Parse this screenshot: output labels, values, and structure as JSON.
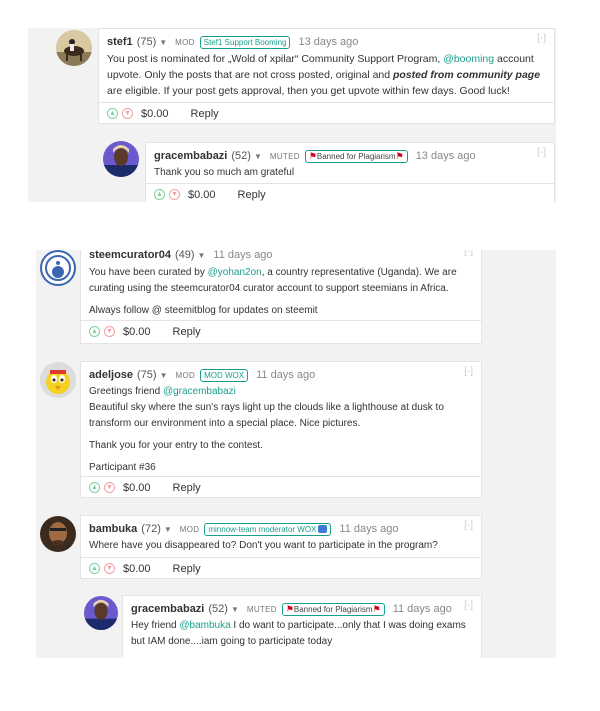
{
  "thread1": {
    "stef1": {
      "author": "stef1",
      "rep": "(75)",
      "role": "MOD",
      "tag": "Stef1 Support Booming",
      "time": "13 days ago",
      "collapse": "[-]",
      "body": {
        "p1": "You post is nominated for „Wold of xpilar“ Community Support Program, ",
        "link": "@booming",
        "p2": " account upvote. Only the posts that are not cross posted, original and ",
        "bold": "posted from community page",
        "p3": " are eligible. If your post gets approval, then you get upvote within few days. Good luck!"
      },
      "payout": "$0.00",
      "reply": "Reply"
    },
    "grace1": {
      "author": "gracembabazi",
      "rep": "(52)",
      "role": "MUTED",
      "tag": "Banned for Plagiarism",
      "time": "13 days ago",
      "collapse": "[-]",
      "body": "Thank you so much am grateful",
      "payout": "$0.00",
      "reply": "Reply"
    }
  },
  "thread2": {
    "curator": {
      "author": "steemcurator04",
      "rep": "(49)",
      "time": "11 days ago",
      "collapse": "[-]",
      "body": {
        "p1a": "You have been curated by ",
        "link": "@yohan2on",
        "p1b": ", a country representative (Uganda). We are curating using the steemcurator04 curator account to support steemians in Africa.",
        "p2": "Always follow @ steemitblog for updates on steemit"
      },
      "payout": "$0.00",
      "reply": "Reply"
    },
    "adel": {
      "author": "adeljose",
      "rep": "(75)",
      "role": "MOD",
      "tag": "MOD WOX",
      "time": "11 days ago",
      "collapse": "[-]",
      "body": {
        "greet": "Greetings friend ",
        "link": "@gracembabazi",
        "p1": "Beautiful sky where the sun's rays light up the clouds like a lighthouse at dusk to transform our environment into a special place. Nice pictures.",
        "p2": "Thank you for your entry to the contest.",
        "p3": "Participant #36"
      },
      "payout": "$0.00",
      "reply": "Reply"
    },
    "bambuka": {
      "author": "bambuka",
      "rep": "(72)",
      "role": "MOD",
      "tag": "minnow-team moderator WOX",
      "time": "11 days ago",
      "collapse": "[-]",
      "body": "Where have you disappeared to? Don't you want to participate in the program?",
      "payout": "$0.00",
      "reply": "Reply"
    },
    "grace2": {
      "author": "gracembabazi",
      "rep": "(52)",
      "role": "MUTED",
      "tag": "Banned for Plagiarism",
      "time": "11 days ago",
      "collapse": "[-]",
      "body": {
        "a": "Hey friend ",
        "link": "@bambuka",
        "b": " I do want to participate...only that I was doing exams but IAM done....iam going to participate today"
      }
    }
  },
  "icons": {
    "upvote": "chevron-up-icon",
    "downvote": "chevron-down-icon",
    "flag": "flag-icon"
  },
  "colors": {
    "link": "#1a9f8a",
    "flag": "#d0021b",
    "upvote": "#7fcfa0",
    "downvote": "#f2a0a0"
  }
}
